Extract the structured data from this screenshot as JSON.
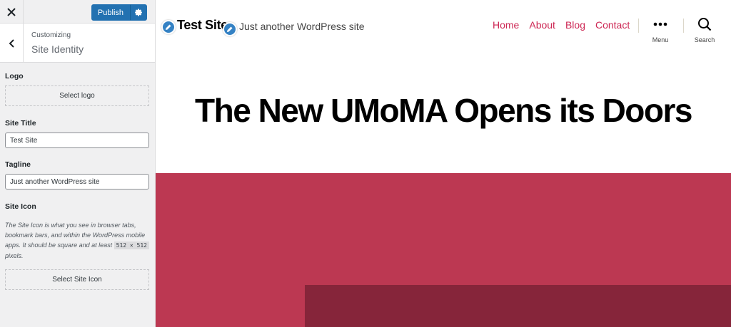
{
  "sidebar": {
    "publish_label": "Publish",
    "breadcrumb": "Customizing",
    "section_title": "Site Identity",
    "logo": {
      "label": "Logo",
      "button": "Select logo"
    },
    "site_title": {
      "label": "Site Title",
      "value": "Test Site"
    },
    "tagline": {
      "label": "Tagline",
      "value": "Just another WordPress site"
    },
    "site_icon": {
      "label": "Site Icon",
      "description": "The Site Icon is what you see in browser tabs, bookmark bars, and within the WordPress mobile apps. It should be square and at least",
      "size_code": "512 × 512",
      "description_end": "pixels.",
      "button": "Select Site Icon"
    }
  },
  "preview": {
    "site_title": "Test Site",
    "tagline": "Just another WordPress site",
    "nav": [
      "Home",
      "About",
      "Blog",
      "Contact"
    ],
    "menu_label": "Menu",
    "search_label": "Search",
    "hero_title": "The New UMoMA Opens its Doors",
    "colors": {
      "accent": "#cd2653",
      "hero_bg": "#bc3852",
      "hero_inner": "#86253a",
      "primary_button": "#2271b1"
    }
  }
}
